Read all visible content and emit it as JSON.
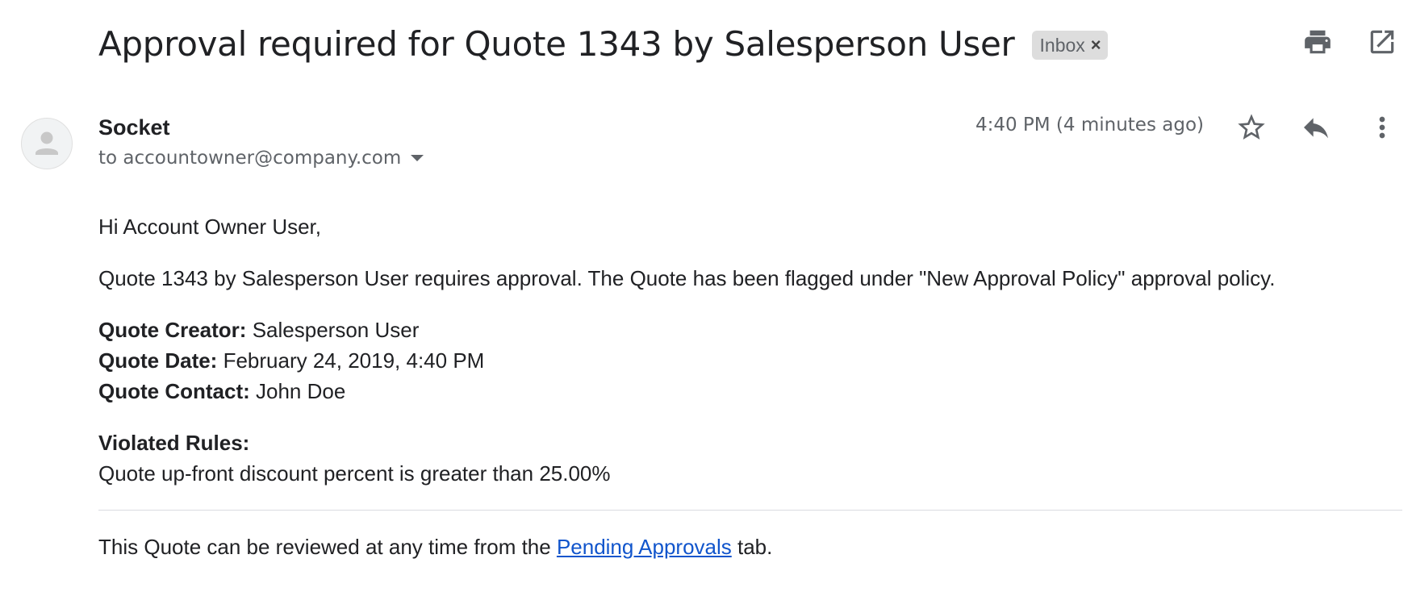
{
  "email": {
    "subject": "Approval required for Quote 1343 by Salesperson User",
    "label": "Inbox",
    "label_close_glyph": "×",
    "sender_name": "Socket",
    "recipient_line": "to accountowner@company.com",
    "timestamp": "4:40 PM (4 minutes ago)"
  },
  "icons": {
    "print": "print-icon",
    "open_new_window": "open-in-new-window-icon",
    "avatar": "default-avatar-icon",
    "star": "star-icon",
    "reply": "reply-icon",
    "more": "more-vertical-icon",
    "recipient_dropdown": "chevron-down-icon"
  },
  "body": {
    "greeting": "Hi Account Owner User,",
    "intro": "Quote 1343 by Salesperson User requires approval. The Quote has been flagged under \"New Approval Policy\" approval policy.",
    "details": [
      {
        "label": "Quote Creator:",
        "value": "Salesperson User"
      },
      {
        "label": "Quote Date:",
        "value": "February 24, 2019, 4:40 PM"
      },
      {
        "label": "Quote Contact:",
        "value": "John Doe"
      }
    ],
    "rules_heading": "Violated Rules:",
    "rules": [
      "Quote up-front discount percent is greater than 25.00%"
    ],
    "footer_prefix": "This Quote can be reviewed at any time from the ",
    "footer_link": "Pending Approvals",
    "footer_suffix": " tab."
  },
  "colors": {
    "text_primary": "#202124",
    "text_secondary": "#5f6368",
    "link": "#1155cc",
    "label_chip_bg": "#dddddd",
    "divider": "#dadce0"
  }
}
